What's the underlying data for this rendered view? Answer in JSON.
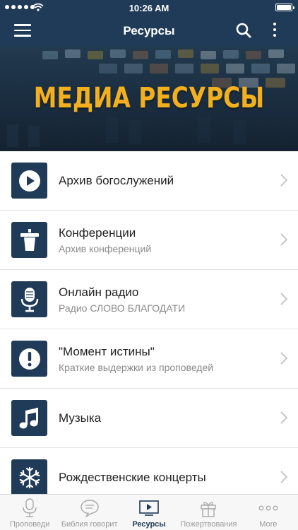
{
  "status_bar": {
    "time": "10:26 AM"
  },
  "nav": {
    "title": "Ресурсы",
    "menu_icon": "hamburger-menu-icon",
    "search_icon": "search-icon",
    "more_icon": "more-vertical-icon"
  },
  "banner": {
    "headline": "МЕДИА РЕСУРСЫ"
  },
  "colors": {
    "navbar": "#1f3b57",
    "accent": "#f2b01e",
    "icon_tile": "#1f3b57"
  },
  "list": [
    {
      "title": "Архив богослужений",
      "subtitle": "",
      "icon": "play-icon"
    },
    {
      "title": "Конференции",
      "subtitle": "Архив конференций",
      "icon": "podium-icon"
    },
    {
      "title": "Онлайн радио",
      "subtitle": "Радио СЛОВО БЛАГОДАТИ",
      "icon": "microphone-icon"
    },
    {
      "title": "\"Момент истины\"",
      "subtitle": "Краткие выдержки из проповедей",
      "icon": "exclamation-icon"
    },
    {
      "title": "Музыка",
      "subtitle": "",
      "icon": "music-note-icon"
    },
    {
      "title": "Рождественские концерты",
      "subtitle": "",
      "icon": "snowflake-icon"
    }
  ],
  "tabs": [
    {
      "label": "Проповеди",
      "icon": "microphone-icon",
      "active": false
    },
    {
      "label": "Библия говорит",
      "icon": "speech-bubble-icon",
      "active": false
    },
    {
      "label": "Ресурсы",
      "icon": "video-play-icon",
      "active": true
    },
    {
      "label": "Пожертвования",
      "icon": "gift-icon",
      "active": false
    },
    {
      "label": "More",
      "icon": "more-horizontal-icon",
      "active": false
    }
  ]
}
